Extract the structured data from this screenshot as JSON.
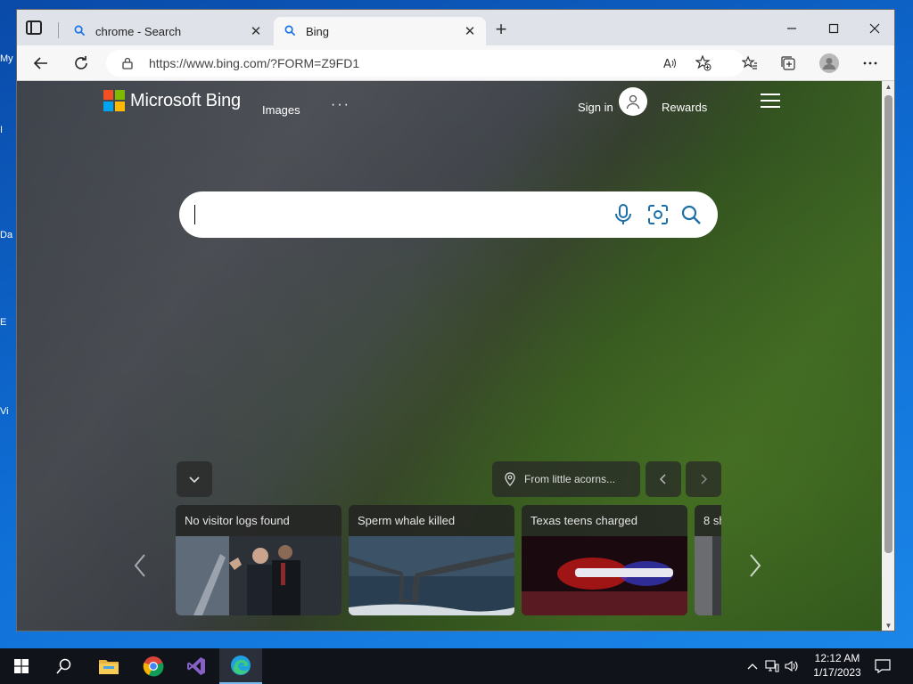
{
  "desktop": {
    "icon_labels": [
      "My",
      "I",
      "Da",
      "E",
      "Vi"
    ]
  },
  "browser": {
    "tabs": [
      {
        "label": "chrome - Search",
        "active": false,
        "icon": "search-icon"
      },
      {
        "label": "Bing",
        "active": true,
        "icon": "search-icon"
      }
    ],
    "url": "https://www.bing.com/?FORM=Z9FD1",
    "icons": [
      "tab-actions-icon",
      "back-icon",
      "refresh-icon",
      "lock-icon",
      "read-aloud-icon",
      "add-favorite-icon",
      "favorites-icon",
      "collections-icon",
      "profile-icon",
      "more-icon",
      "minimize-icon",
      "maximize-icon",
      "close-icon"
    ]
  },
  "bing": {
    "logo_text": "Microsoft Bing",
    "nav_images": "Images",
    "nav_more": "···",
    "sign_in": "Sign in",
    "rewards": "Rewards",
    "info_text": "From little acorns...",
    "cards": [
      {
        "title": "No visitor logs found"
      },
      {
        "title": "Sperm whale killed"
      },
      {
        "title": "Texas teens charged"
      },
      {
        "title": "8 sh"
      }
    ]
  },
  "taskbar": {
    "time": "12:12 AM",
    "date": "1/17/2023",
    "apps": [
      "start-icon",
      "search-icon",
      "file-explorer-icon",
      "chrome-icon",
      "visual-studio-icon",
      "edge-icon"
    ]
  },
  "colors": {
    "ms_red": "#f25022",
    "ms_green": "#7fba00",
    "ms_blue": "#00a4ef",
    "ms_yellow": "#ffb900",
    "bing_icon": "#1e6fa8"
  }
}
